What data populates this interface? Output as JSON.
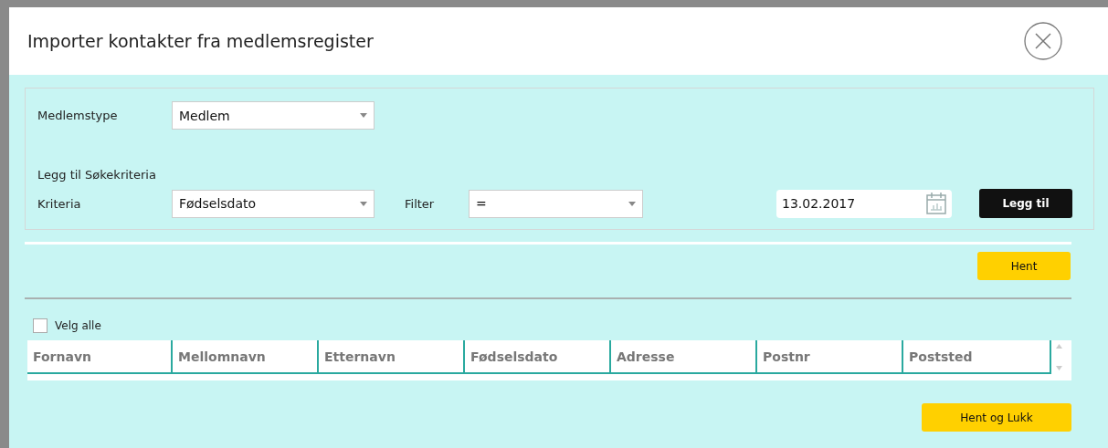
{
  "dialog": {
    "title": "Importer kontakter fra medlemsregister"
  },
  "member_type": {
    "label": "Medlemstype",
    "value": "Medlem"
  },
  "criteria_heading": "Legg til Søkekriteria",
  "criteria": {
    "label": "Kriteria",
    "value": "Fødselsdato"
  },
  "filter": {
    "label": "Filter",
    "value": "="
  },
  "date_field": {
    "value": "13.02.2017"
  },
  "add_button": "Legg til",
  "fetch_button": "Hent",
  "select_all": {
    "label": "Velg alle",
    "checked": false
  },
  "table": {
    "columns": [
      "Fornavn",
      "Mellomnavn",
      "Etternavn",
      "Fødselsdato",
      "Adresse",
      "Postnr",
      "Poststed"
    ]
  },
  "fetch_close_button": "Hent og Lukk"
}
